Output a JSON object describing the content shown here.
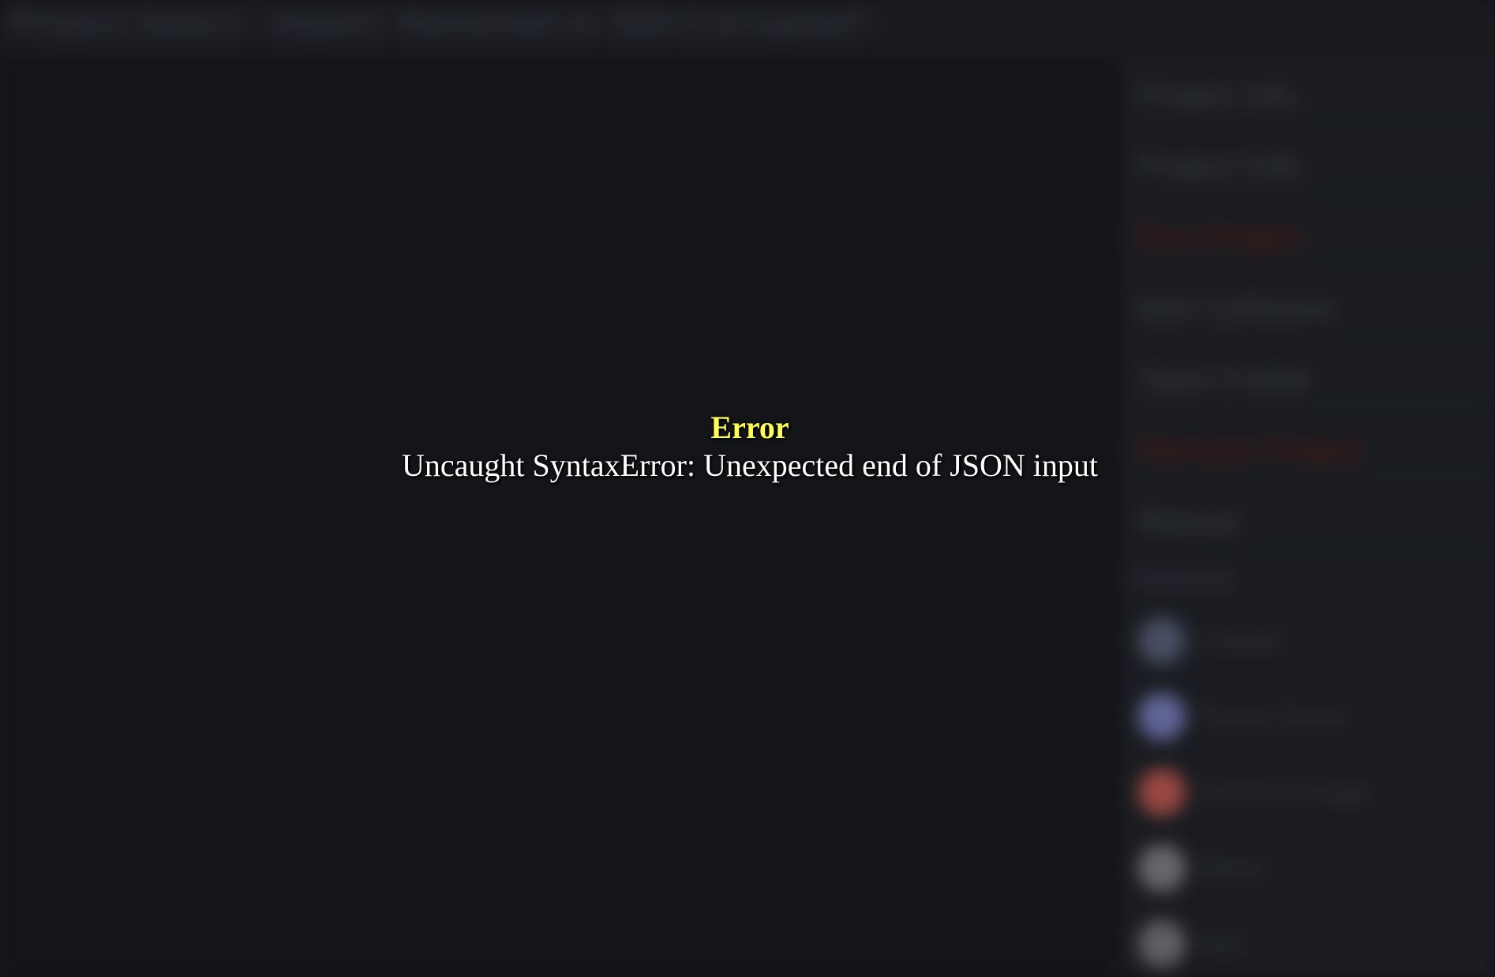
{
  "window": {
    "title": "Project Select - Import: Removed or Still Corrupted?"
  },
  "panel": {
    "rows": [
      {
        "label": "Project Info",
        "tone": "normal"
      },
      {
        "label": "Project Edit",
        "tone": "normal"
      },
      {
        "label": "Run Project",
        "tone": "danger"
      },
      {
        "label": "Edit Collisions",
        "tone": "normal"
      },
      {
        "label": "Open Folder",
        "tone": "normal"
      },
      {
        "label": "Remove Project",
        "tone": "danger"
      },
      {
        "label": "Reload",
        "tone": "normal"
      }
    ],
    "section_title": "Recents",
    "recents": [
      {
        "label": "Untitled",
        "avatar_color": "#4a5166"
      },
      {
        "label": "Forest Scene",
        "avatar_color": "#646a9e"
      },
      {
        "label": "Cavern Escape",
        "avatar_color": "#a04a44"
      },
      {
        "label": "Demo",
        "avatar_color": "#6a6c72"
      },
      {
        "label": "Test",
        "avatar_color": "#62646a"
      }
    ]
  },
  "error": {
    "title": "Error",
    "message": "Uncaught SyntaxError: Unexpected end of JSON input"
  },
  "colors": {
    "background": "#141519",
    "error_title": "#ffff55",
    "error_message": "#ffffff",
    "danger": "#5a1a12"
  }
}
